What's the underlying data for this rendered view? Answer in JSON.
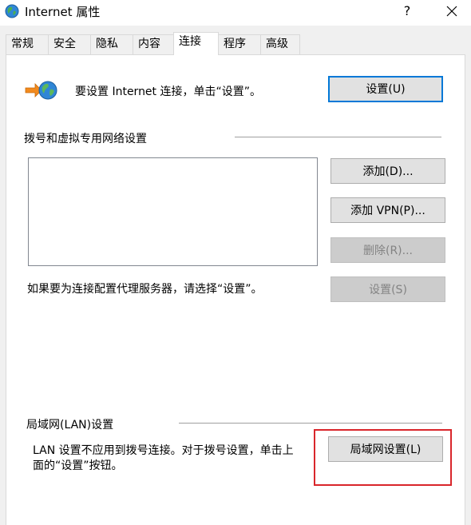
{
  "window": {
    "title": "Internet 属性",
    "help_label": "?",
    "icon": "globe-icon"
  },
  "tabs": [
    {
      "label": "常规"
    },
    {
      "label": "安全"
    },
    {
      "label": "隐私"
    },
    {
      "label": "内容"
    },
    {
      "label": "连接",
      "active": true
    },
    {
      "label": "程序"
    },
    {
      "label": "高级"
    }
  ],
  "setup": {
    "text": "要设置 Internet 连接，单击“设置”。",
    "button_label": "设置(U)",
    "icon": "network-setup-icon"
  },
  "dialup": {
    "heading": "拨号和虚拟专用网络设置",
    "add_label": "添加(D)...",
    "add_vpn_label": "添加 VPN(P)...",
    "remove_label": "删除(R)...",
    "settings_label": "设置(S)",
    "proxy_text": "如果要为连接配置代理服务器，请选择“设置”。"
  },
  "lan": {
    "heading": "局域网(LAN)设置",
    "description_line1": "LAN 设置不应用到拨号连接。对于拨号设置，单击上",
    "description_line2": "面的“设置”按钮。",
    "button_label": "局域网设置(L)"
  },
  "colors": {
    "accent": "#0078d7",
    "highlight": "#d9262b",
    "panel_bg": "#ffffff",
    "window_bg": "#f0f0f0"
  }
}
